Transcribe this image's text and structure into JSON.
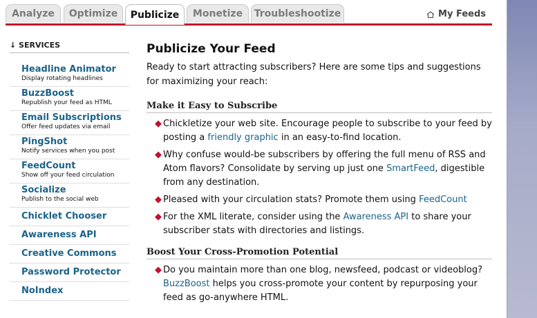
{
  "tabs": [
    {
      "label": "Analyze"
    },
    {
      "label": "Optimize"
    },
    {
      "label": "Publicize"
    },
    {
      "label": "Monetize"
    },
    {
      "label": "Troubleshootize"
    }
  ],
  "my_feeds_label": "My Feeds",
  "services": {
    "heading": "↓ SERVICES",
    "items": [
      {
        "name": "Headline Animator",
        "desc": "Display rotating headlines"
      },
      {
        "name": "BuzzBoost",
        "desc": "Republish your feed as HTML"
      },
      {
        "name": "Email Subscriptions",
        "desc": "Offer feed updates via email"
      },
      {
        "name": "PingShot",
        "desc": "Notify services when you post"
      },
      {
        "name": "FeedCount",
        "desc": "Show off your feed circulation"
      },
      {
        "name": "Socialize",
        "desc": "Publish to the social web"
      },
      {
        "name": "Chicklet Chooser"
      },
      {
        "name": "Awareness API"
      },
      {
        "name": "Creative Commons"
      },
      {
        "name": "Password Protector"
      },
      {
        "name": "NoIndex"
      }
    ]
  },
  "main": {
    "title": "Publicize Your Feed",
    "intro": "Ready to start attracting subscribers? Here are some tips and suggestions for maximizing your reach:",
    "section1": {
      "title": "Make it Easy to Subscribe",
      "b1_pre": "Chickletize your web site. Encourage people to subscribe to your feed by posting a ",
      "b1_link": "friendly graphic",
      "b1_post": " in an easy-to-find location.",
      "b2_pre": "Why confuse would-be subscribers by offering the full menu of RSS and Atom flavors? Consolidate by serving up just one ",
      "b2_link": "SmartFeed",
      "b2_post": ", digestible from any destination.",
      "b3_pre": "Pleased with your circulation stats? Promote them using ",
      "b3_link": "FeedCount",
      "b4_pre": "For the XML literate, consider using the ",
      "b4_link": "Awareness API",
      "b4_post": " to share your subscriber stats with directories and listings."
    },
    "section2": {
      "title": "Boost Your Cross-Promotion Potential",
      "b1_pre": "Do you maintain more than one blog, newsfeed, podcast or videoblog? ",
      "b1_link": "BuzzBoost",
      "b1_post": " helps you cross-promote your content by repurposing your feed as go-anywhere HTML."
    }
  },
  "colors": {
    "accent": "#c40f2e",
    "link": "#1b6389"
  },
  "icons": {
    "my_feeds": "home-icon",
    "bullet": "diamond-bullet"
  }
}
